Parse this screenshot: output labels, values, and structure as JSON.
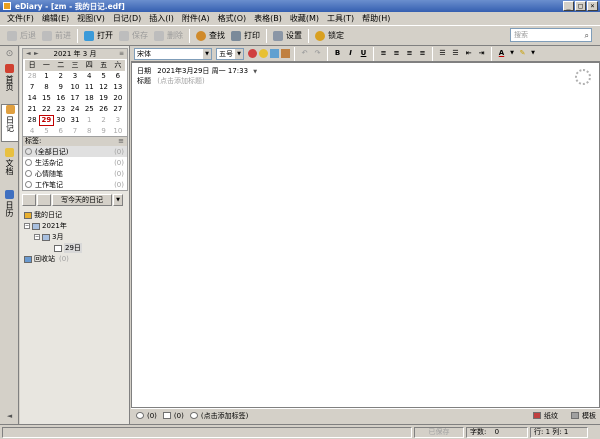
{
  "window": {
    "title": "eDiary - [zm - 我的日记.edf]"
  },
  "menu": [
    "文件(F)",
    "编辑(E)",
    "视图(V)",
    "日记(D)",
    "插入(I)",
    "附件(A)",
    "格式(O)",
    "表格(B)",
    "收藏(M)",
    "工具(T)",
    "帮助(H)"
  ],
  "toolbar": {
    "back": "后退",
    "forward": "前进",
    "open": "打开",
    "save": "保存",
    "delete": "删除",
    "find": "查找",
    "print": "打印",
    "settings": "设置",
    "lock": "锁定",
    "search_placeholder": "搜索"
  },
  "side_tabs": [
    "首页",
    "日记",
    "文档",
    "日历"
  ],
  "calendar": {
    "title": "2021 年 3 月",
    "weekdays": [
      "日",
      "一",
      "二",
      "三",
      "四",
      "五",
      "六"
    ],
    "days": [
      {
        "t": "28",
        "m": false
      },
      {
        "t": "1",
        "m": true
      },
      {
        "t": "2",
        "m": true
      },
      {
        "t": "3",
        "m": true
      },
      {
        "t": "4",
        "m": true
      },
      {
        "t": "5",
        "m": true
      },
      {
        "t": "6",
        "m": true
      },
      {
        "t": "7",
        "m": true
      },
      {
        "t": "8",
        "m": true
      },
      {
        "t": "9",
        "m": true
      },
      {
        "t": "10",
        "m": true
      },
      {
        "t": "11",
        "m": true
      },
      {
        "t": "12",
        "m": true
      },
      {
        "t": "13",
        "m": true
      },
      {
        "t": "14",
        "m": true
      },
      {
        "t": "15",
        "m": true
      },
      {
        "t": "16",
        "m": true
      },
      {
        "t": "17",
        "m": true
      },
      {
        "t": "18",
        "m": true
      },
      {
        "t": "19",
        "m": true
      },
      {
        "t": "20",
        "m": true
      },
      {
        "t": "21",
        "m": true
      },
      {
        "t": "22",
        "m": true
      },
      {
        "t": "23",
        "m": true
      },
      {
        "t": "24",
        "m": true
      },
      {
        "t": "25",
        "m": true
      },
      {
        "t": "26",
        "m": true
      },
      {
        "t": "27",
        "m": true
      },
      {
        "t": "28",
        "m": true
      },
      {
        "t": "29",
        "m": true,
        "today": true
      },
      {
        "t": "30",
        "m": true
      },
      {
        "t": "31",
        "m": true
      },
      {
        "t": "1",
        "m": false
      },
      {
        "t": "2",
        "m": false
      },
      {
        "t": "3",
        "m": false
      },
      {
        "t": "4",
        "m": false
      },
      {
        "t": "5",
        "m": false
      },
      {
        "t": "6",
        "m": false
      },
      {
        "t": "7",
        "m": false
      },
      {
        "t": "8",
        "m": false
      },
      {
        "t": "9",
        "m": false
      },
      {
        "t": "10",
        "m": false
      }
    ]
  },
  "tags": {
    "header": "标签:",
    "items": [
      {
        "label": "(全部日记)",
        "count": "(0)"
      },
      {
        "label": "生活杂记",
        "count": "(0)"
      },
      {
        "label": "心情随笔",
        "count": "(0)"
      },
      {
        "label": "工作笔记",
        "count": "(0)"
      }
    ]
  },
  "write_today": "写今天的日记",
  "tree": {
    "root": "我的日记",
    "year": "2021年",
    "month": "3月",
    "day": "29日",
    "recycle": "回收站",
    "recycle_count": "(0)"
  },
  "format": {
    "font": "宋体",
    "size": "五号"
  },
  "entry": {
    "date_label": "日期",
    "date_value": "2021年3月29日  周一  17:33",
    "title_label": "标题",
    "title_placeholder": "(点击添加标题)"
  },
  "bottom": {
    "comments": "(0)",
    "attachments": "(0)",
    "add_tag": "(点击添加标签)",
    "paper": "纸纹",
    "template": "模板"
  },
  "status": {
    "saved": "已保存",
    "words_label": "字数:",
    "words": "0",
    "row_col": "行: 1   列: 1"
  }
}
